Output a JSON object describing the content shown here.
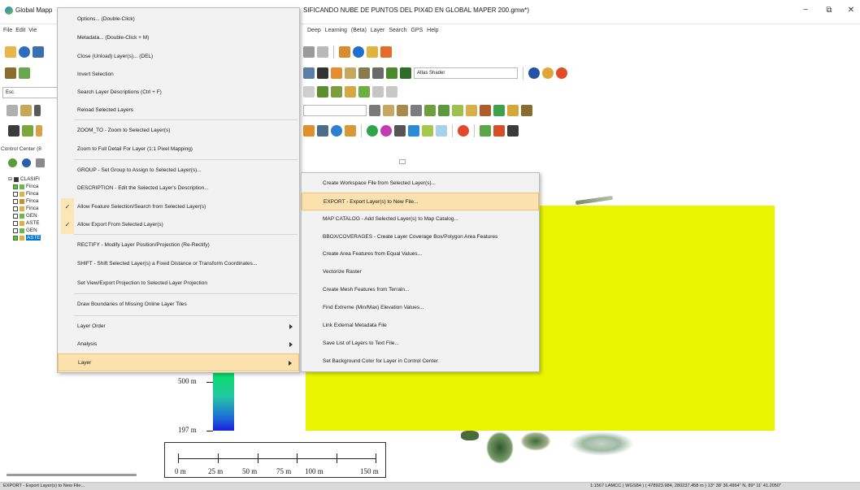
{
  "window": {
    "title_left": "Global Mapp",
    "title_right": "SIFICANDO NUBE DE PUNTOS DEL PIX4D EN GLOBAL MAPER 200.gmw*)",
    "minimize": "−",
    "restore": "⧉",
    "close": "✕"
  },
  "menubar": {
    "left": "File Edit Vie",
    "right": "Deep Learning (Beta) Layer Search GPS Help"
  },
  "toolbar": {
    "search_value": "Esc",
    "shader_dropdown": "Atlas Shader"
  },
  "control_center": {
    "title": "Control Center (8",
    "root_label": "CLASIFI",
    "layers": [
      {
        "label": "Finca",
        "checked": true,
        "icon_color": "#6bb84a"
      },
      {
        "label": "Finca",
        "checked": false,
        "icon_color": "#d8b248"
      },
      {
        "label": "Finca",
        "checked": false,
        "icon_color": "#c98f2a"
      },
      {
        "label": "Finca",
        "checked": false,
        "icon_color": "#d8b248"
      },
      {
        "label": "GEN",
        "checked": false,
        "icon_color": "#6bb84a"
      },
      {
        "label": "ASTE",
        "checked": false,
        "icon_color": "#d8b248"
      },
      {
        "label": "GEN",
        "checked": false,
        "icon_color": "#6bb84a"
      },
      {
        "label": "ASTE",
        "checked": true,
        "icon_color": "#d8b248",
        "selected": true
      }
    ]
  },
  "context_menu": {
    "items": [
      {
        "label": "Options... (Double-Click)"
      },
      {
        "label": "Metadata... (Double-Click + M)"
      },
      {
        "label": "Close (Unload) Layer(s)... (DEL)"
      },
      {
        "label": "Invert Selection"
      },
      {
        "label": "Search Layer Descriptions (Ctrl + F)"
      },
      {
        "label": "Reload Selected Layers"
      },
      {
        "label": "ZOOM_TO - Zoom to Selected Layer(s)"
      },
      {
        "label": "Zoom to Full Detail For Layer (1:1 Pixel Mapping)"
      },
      {
        "label": "GROUP - Set Group to Assign to Selected Layer(s)..."
      },
      {
        "label": "DESCRIPTION - Edit the Selected Layer's Description..."
      },
      {
        "label": "Allow Feature Selection/Search from Selected Layer(s)",
        "checked": true
      },
      {
        "label": "Allow Export From Selected Layer(s)",
        "checked": true
      },
      {
        "label": "RECTIFY - Modify Layer Position/Projection (Re-Rectify)"
      },
      {
        "label": "SHIFT - Shift Selected Layer(s) a Fixed Distance or Transform Coordinates..."
      },
      {
        "label": "Set View/Export Projection to Selected Layer Projection"
      },
      {
        "label": "Draw Boundaries of Missing Online Layer Tiles"
      },
      {
        "label": "Layer Order",
        "submenu": true
      },
      {
        "label": "Analysis",
        "submenu": true
      },
      {
        "label": "Layer",
        "submenu": true,
        "highlighted": true
      }
    ],
    "check_glyph": "✓"
  },
  "submenu": {
    "items": [
      {
        "label": "Create Workspace File from Selected Layer(s)..."
      },
      {
        "label": "EXPORT - Export Layer(s) to New File...",
        "highlighted": true
      },
      {
        "label": "MAP CATALOG - Add Selected Layer(s) to Map Catalog..."
      },
      {
        "label": "BBOX/COVERAGES  - Create Layer Coverage Box/Polygon Area Features"
      },
      {
        "label": "Create Area Features from Equal Values..."
      },
      {
        "label": "Vectorize Raster"
      },
      {
        "label": "Create Mesh Features from Terrain..."
      },
      {
        "label": "Find Extreme (Min/Max) Elevation Values..."
      },
      {
        "label": "Link External Metadata File"
      },
      {
        "label": "Save List of Layers to Text File..."
      },
      {
        "label": "Set Background Color for Layer in Control Center"
      }
    ]
  },
  "legend": {
    "high_label": "500 m",
    "low_label": "197 m"
  },
  "scale_bar": {
    "labels": [
      "0 m",
      "25 m",
      "50 m",
      "75 m",
      "100 m",
      "150 m"
    ]
  },
  "status": {
    "left": "EXPORT - Export Layer(s) to New File...",
    "right": "1:1567  LAMCC ( WGS84 ) ( 478923.984, 280237.458 m ) 13° 38' 36.4964\" N, 89° 11' 41.2050\""
  },
  "colors": {
    "accent": "#0078d7",
    "menu_highlight": "#fbe1ad",
    "raster_yellow": "#e9f500"
  }
}
